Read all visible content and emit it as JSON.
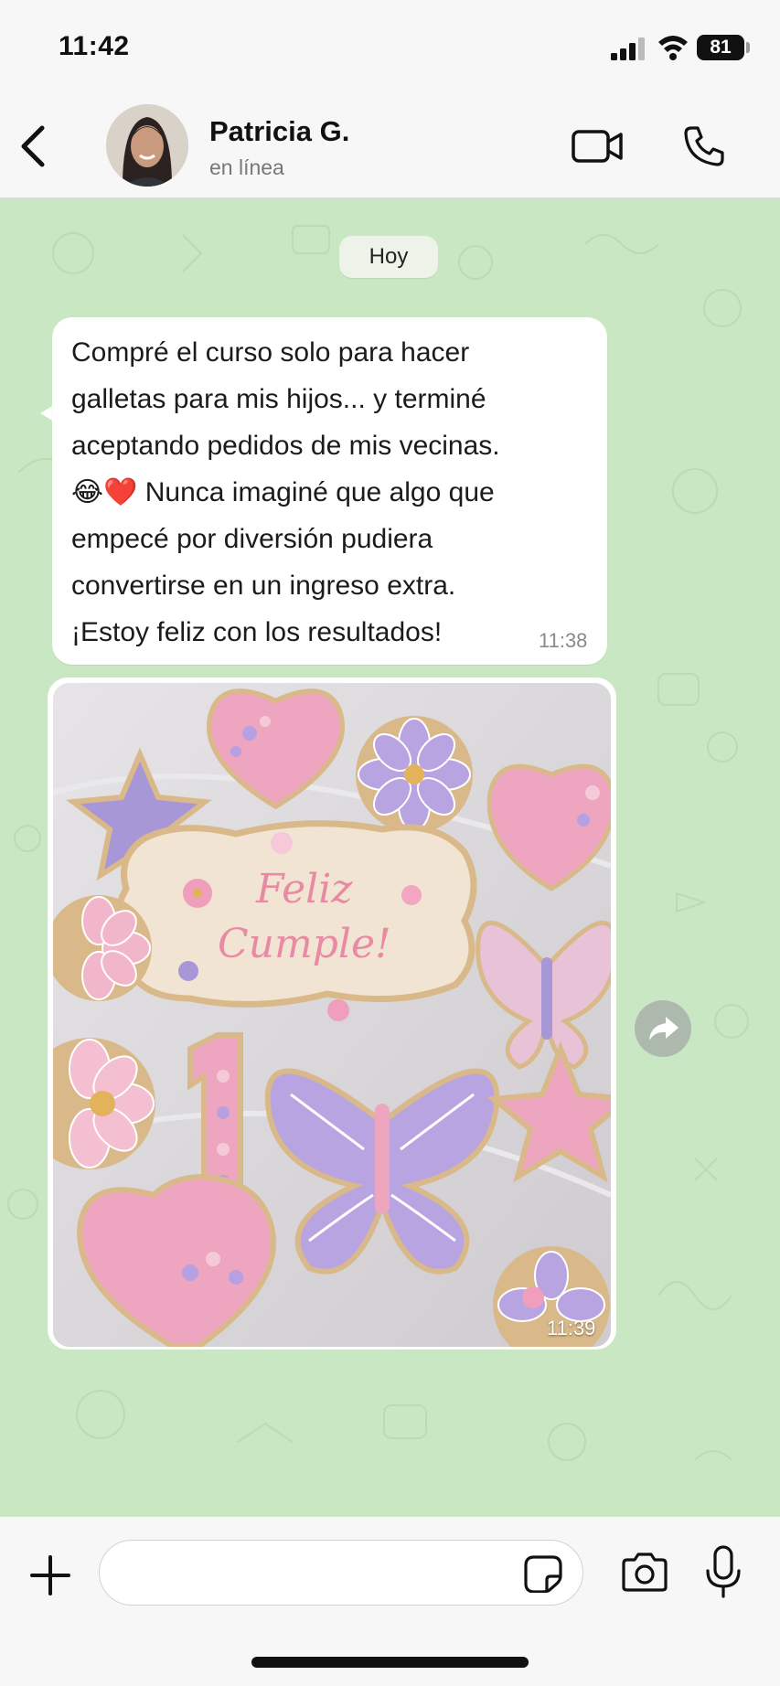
{
  "status_bar": {
    "time": "11:42",
    "battery": "81"
  },
  "header": {
    "contact_name": "Patricia G.",
    "contact_status": "en línea"
  },
  "chat": {
    "date_chip": "Hoy",
    "messages": [
      {
        "lines": [
          "Compré el curso solo para hacer",
          "galletas para mis hijos... y terminé",
          "aceptando pedidos de mis vecinas.",
          "😂❤️ Nunca imaginé que algo que",
          "empecé por diversión pudiera",
          "convertirse en un ingreso extra.",
          "¡Estoy feliz con los resultados!"
        ],
        "time": "11:38"
      },
      {
        "type": "image",
        "cookie_text_1": "Feliz",
        "cookie_text_2": "Cumple!",
        "cookie_number": "1",
        "time": "11:39"
      }
    ]
  },
  "icons": [
    "back-arrow-icon",
    "video-call-icon",
    "phone-icon",
    "forward-icon",
    "plus-icon",
    "sticker-icon",
    "camera-icon",
    "microphone-icon"
  ],
  "colors": {
    "chat_background": "#c9e7c2",
    "bubble": "#ffffff",
    "accent_pink": "#f29bb8",
    "accent_lilac": "#b8a4e0"
  }
}
